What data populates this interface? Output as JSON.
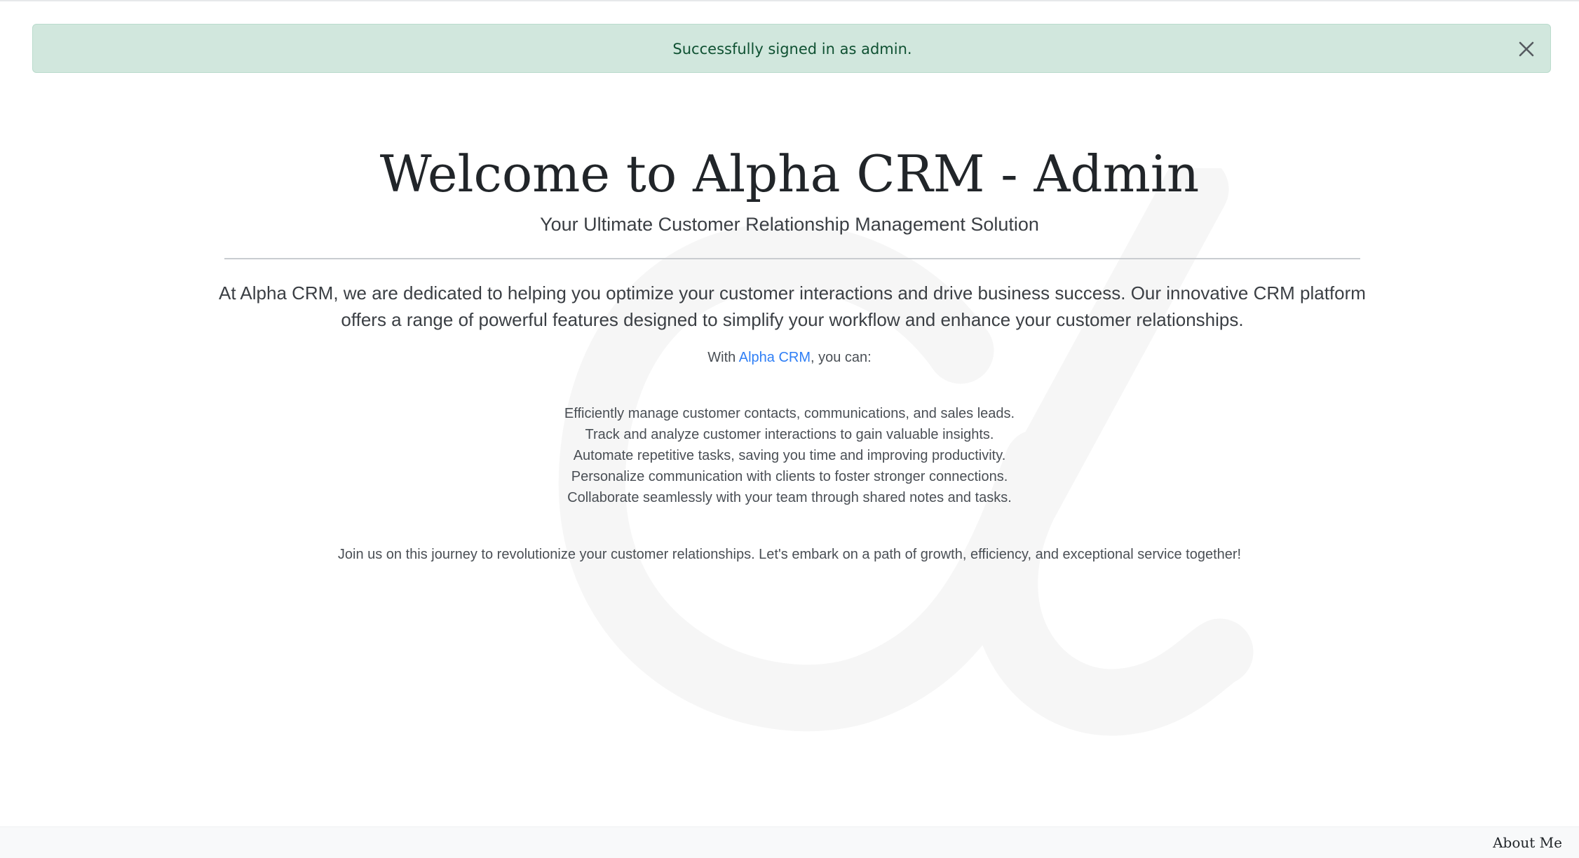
{
  "alert": {
    "message": "Successfully signed in as admin.",
    "close_icon": "close-icon"
  },
  "hero": {
    "title": "Welcome to Alpha CRM - Admin",
    "subtitle": "Your Ultimate Customer Relationship Management Solution",
    "watermark_icon": "alpha-letter-icon"
  },
  "intro": {
    "lead": "At Alpha CRM, we are dedicated to helping you optimize your customer interactions and drive business success. Our innovative CRM platform offers a range of powerful features designed to simplify your workflow and enhance your customer relationships.",
    "with_prefix": "With ",
    "brand_link": "Alpha CRM",
    "with_suffix": ", you can:"
  },
  "features": [
    "Efficiently manage customer contacts, communications, and sales leads.",
    "Track and analyze customer interactions to gain valuable insights.",
    "Automate repetitive tasks, saving you time and improving productivity.",
    "Personalize communication with clients to foster stronger connections.",
    "Collaborate seamlessly with your team through shared notes and tasks."
  ],
  "closing": "Join us on this journey to revolutionize your customer relationships. Let's embark on a path of growth, efficiency, and exceptional service together!",
  "footer": {
    "about_link": "About Me"
  },
  "colors": {
    "alert_bg": "#d1e7dd",
    "alert_text": "#0f5132",
    "link": "#2f7ff6",
    "footer_bg": "#f8f9fa"
  }
}
